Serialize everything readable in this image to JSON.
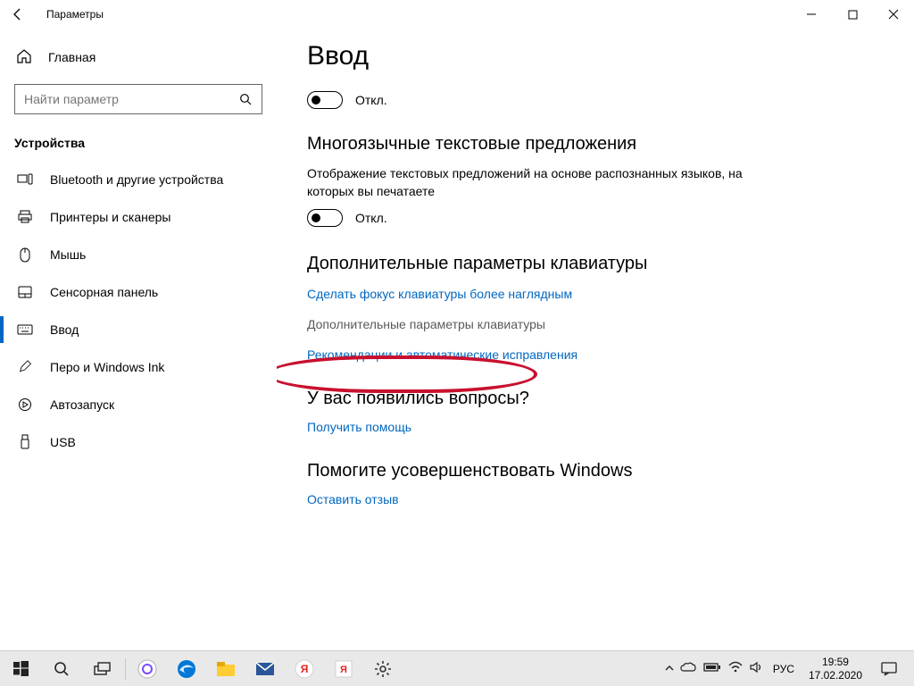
{
  "window": {
    "title": "Параметры"
  },
  "sidebar": {
    "home": "Главная",
    "search_placeholder": "Найти параметр",
    "category": "Устройства",
    "items": [
      {
        "label": "Bluetooth и другие устройства"
      },
      {
        "label": "Принтеры и сканеры"
      },
      {
        "label": "Мышь"
      },
      {
        "label": "Сенсорная панель"
      },
      {
        "label": "Ввод"
      },
      {
        "label": "Перо и Windows Ink"
      },
      {
        "label": "Автозапуск"
      },
      {
        "label": "USB"
      }
    ]
  },
  "content": {
    "page_title": "Ввод",
    "toggle1_label": "Откл.",
    "section_multilang": "Многоязычные текстовые предложения",
    "multilang_desc": "Отображение текстовых предложений на основе распознанных языков, на которых вы печатаете",
    "toggle2_label": "Откл.",
    "section_advanced": "Дополнительные параметры клавиатуры",
    "link_focus": "Сделать фокус клавиатуры более наглядным",
    "link_advanced": "Дополнительные параметры клавиатуры",
    "link_autocorrect": "Рекомендации и автоматические исправления",
    "section_questions": "У вас появились вопросы?",
    "link_help": "Получить помощь",
    "section_feedback": "Помогите усовершенствовать Windows",
    "link_feedback": "Оставить отзыв"
  },
  "taskbar": {
    "lang": "РУС",
    "time": "19:59",
    "date": "17.02.2020"
  }
}
